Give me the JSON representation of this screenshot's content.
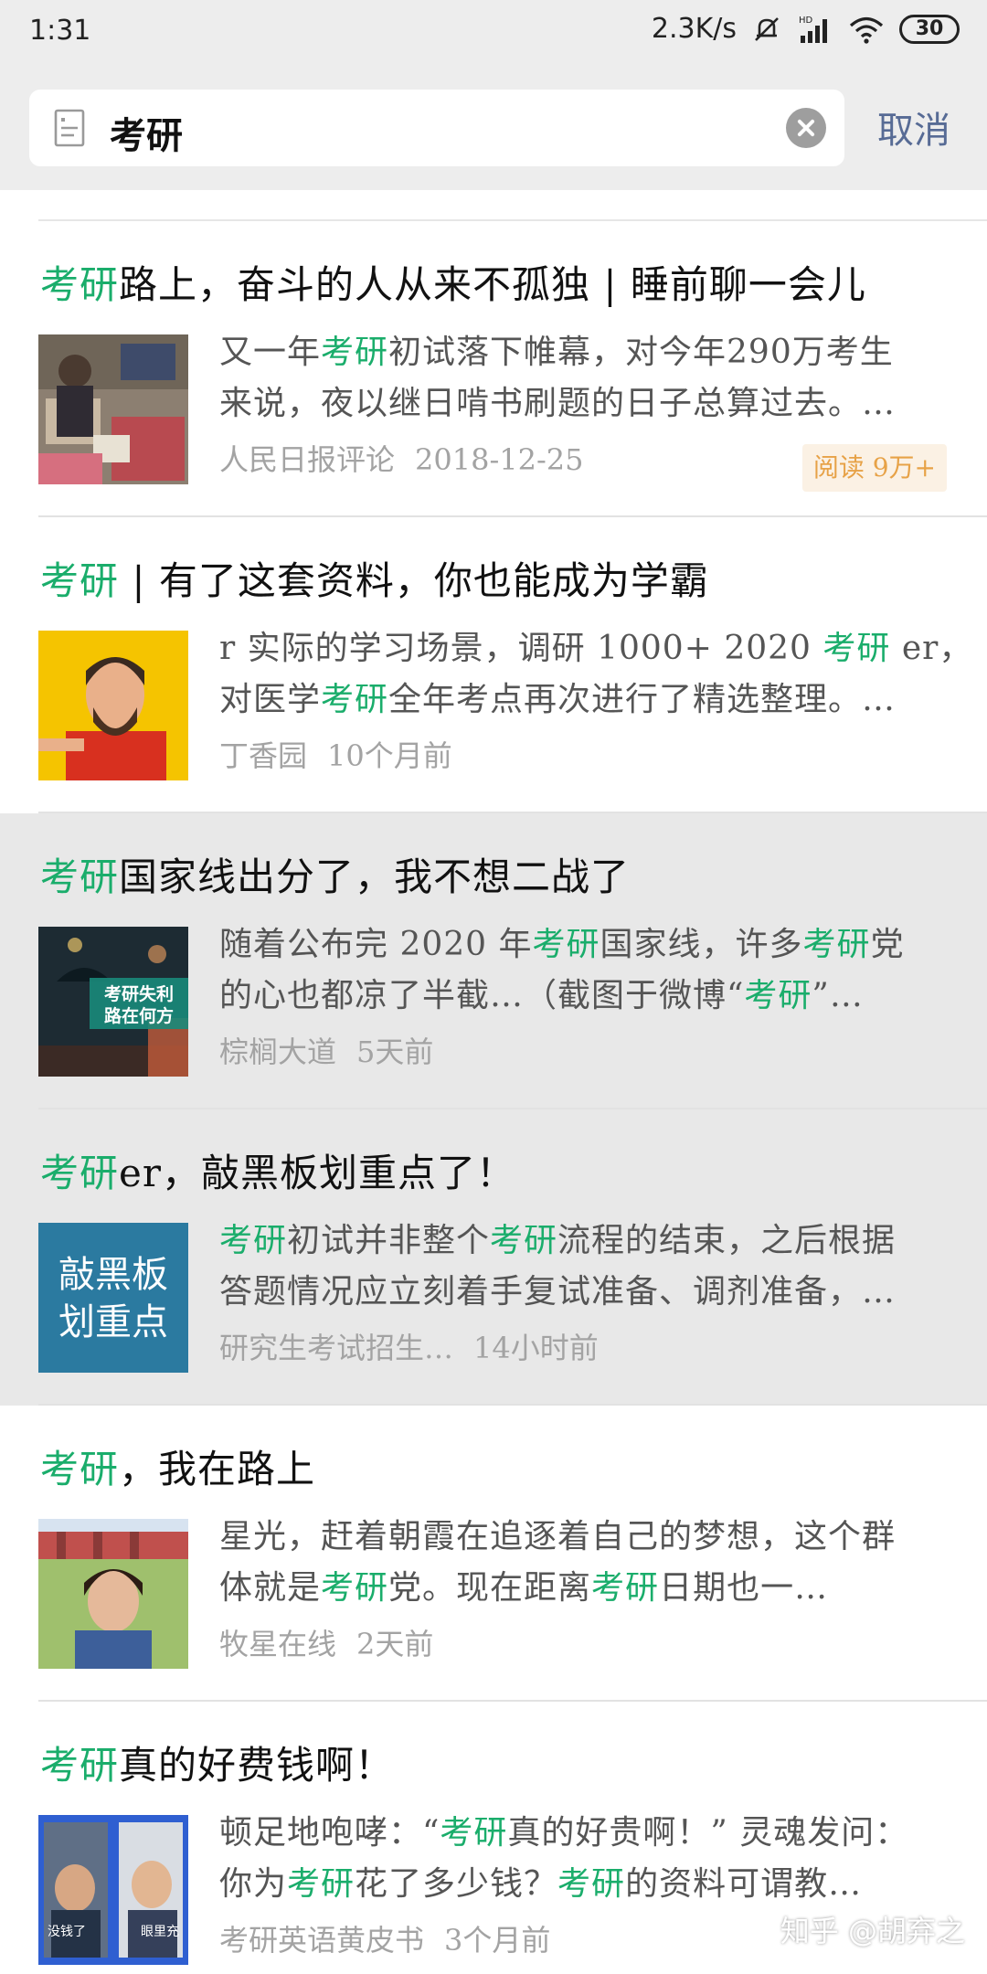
{
  "status_bar": {
    "time": "1:31",
    "net_speed": "2.3K/s",
    "battery": "30"
  },
  "search": {
    "query": "考研",
    "cancel_label": "取消"
  },
  "results": [
    {
      "title_hl": "考研",
      "title_rest": "路上，奋斗的人从来不孤独 | 睡前聊一会儿",
      "summary_line1": [
        {
          "t": "又一年",
          "h": false
        },
        {
          "t": "考研",
          "h": true
        },
        {
          "t": "初试落下帷幕，对今年290万考生",
          "h": false
        }
      ],
      "summary_line2": [
        {
          "t": "来说，夜以继日啃书刷题的日子总算过去。…",
          "h": false
        }
      ],
      "source": "人民日报评论",
      "date": "2018-12-25",
      "badge": "阅读 9万+"
    },
    {
      "title_hl": "考研",
      "title_rest": " | 有了这套资料，你也能成为学霸",
      "summary_line1": [
        {
          "t": "r 实际的学习场景，调研 1000+ 2020 ",
          "h": false
        },
        {
          "t": "考研",
          "h": true
        },
        {
          "t": " er，",
          "h": false
        }
      ],
      "summary_line2": [
        {
          "t": "对医学",
          "h": false
        },
        {
          "t": "考研",
          "h": true
        },
        {
          "t": "全年考点再次进行了精选整理。…",
          "h": false
        }
      ],
      "source": "丁香园",
      "date": "10个月前"
    },
    {
      "title_hl": "考研",
      "title_rest": "国家线出分了，我不想二战了",
      "summary_line1": [
        {
          "t": "随着公布完 2020 年",
          "h": false
        },
        {
          "t": "考研",
          "h": true
        },
        {
          "t": "国家线，许多",
          "h": false
        },
        {
          "t": "考研",
          "h": true
        },
        {
          "t": "党",
          "h": false
        }
      ],
      "summary_line2": [
        {
          "t": "的心也都凉了半截…（截图于微博“",
          "h": false
        },
        {
          "t": "考研",
          "h": true
        },
        {
          "t": "”…",
          "h": false
        }
      ],
      "source": "棕榈大道",
      "date": "5天前",
      "thumb_text": [
        "考研失利",
        "路在何方"
      ]
    },
    {
      "title_hl": "考研",
      "title_rest": "er，敲黑板划重点了！",
      "summary_line1": [
        {
          "t": "考研",
          "h": true
        },
        {
          "t": "初试并非整个",
          "h": false
        },
        {
          "t": "考研",
          "h": true
        },
        {
          "t": "流程的结束，之后根据",
          "h": false
        }
      ],
      "summary_line2": [
        {
          "t": "答题情况应立刻着手复试准备、调剂准备，…",
          "h": false
        }
      ],
      "source": "研究生考试招生…",
      "date": "14小时前",
      "thumb_text": [
        "敲黑板",
        "划重点"
      ]
    },
    {
      "title_hl": "考研",
      "title_rest": "，我在路上",
      "summary_line1": [
        {
          "t": "星光，赶着朝霞在追逐着自己的梦想，这个群",
          "h": false
        }
      ],
      "summary_line2": [
        {
          "t": "体就是",
          "h": false
        },
        {
          "t": "考研",
          "h": true
        },
        {
          "t": "党。现在距离",
          "h": false
        },
        {
          "t": "考研",
          "h": true
        },
        {
          "t": "日期也一…",
          "h": false
        }
      ],
      "source": "牧星在线",
      "date": "2天前"
    },
    {
      "title_hl": "考研",
      "title_rest": "真的好费钱啊！",
      "summary_line1": [
        {
          "t": "顿足地咆哮：“",
          "h": false
        },
        {
          "t": "考研",
          "h": true
        },
        {
          "t": "真的好贵啊！” 灵魂发问：",
          "h": false
        }
      ],
      "summary_line2": [
        {
          "t": "你为",
          "h": false
        },
        {
          "t": "考研",
          "h": true
        },
        {
          "t": "花了多少钱？",
          "h": false
        },
        {
          "t": "考研",
          "h": true
        },
        {
          "t": "的资料可谓教…",
          "h": false
        }
      ],
      "source": "考研英语黄皮书",
      "date": "3个月前",
      "thumb_text": [
        "没钱了",
        "眼里充"
      ]
    }
  ],
  "watermark": "知乎 @胡弃之",
  "colors": {
    "highlight": "#1aad6b",
    "cancel": "#576b95",
    "badge_bg": "#fbf1e4",
    "badge_text": "#e7a247",
    "header_bg": "#ededed"
  }
}
